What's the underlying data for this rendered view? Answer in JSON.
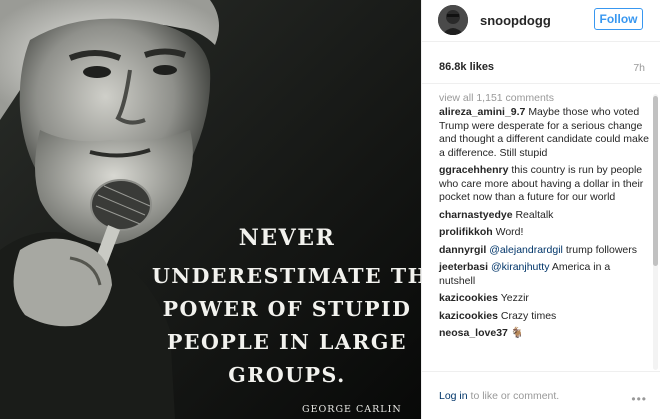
{
  "image": {
    "quote_lines": [
      "NEVER",
      "UNDERESTIMATE THE",
      "POWER OF STUPID",
      "PEOPLE IN LARGE",
      "GROUPS."
    ],
    "attribution": "GEORGE CARLIN"
  },
  "header": {
    "username": "snoopdogg",
    "follow_label": "Follow"
  },
  "stats": {
    "likes": "86.8k likes",
    "time": "7h"
  },
  "comments": {
    "view_all": "view all 1,151 comments",
    "items": [
      {
        "user": "alireza_amini_9.7",
        "text": "Maybe those who voted Trump were desperate for a serious change and thought a different candidate could make a difference. Still stupid"
      },
      {
        "user": "ggracehhenry",
        "text": "this country is run by people who care more about having a dollar in their pocket now than a future for our world"
      },
      {
        "user": "charnastyedye",
        "text": "Realtalk"
      },
      {
        "user": "prolifikkoh",
        "text": "Word!"
      },
      {
        "user": "dannyrgil",
        "mention": "@alejandrardgil",
        "text": "trump followers"
      },
      {
        "user": "jeeterbasi",
        "mention": "@kiranjhutty",
        "text": "America in a nutshell"
      },
      {
        "user": "kazicookies",
        "text": "Yezzir"
      },
      {
        "user": "kazicookies",
        "text": "Crazy times"
      },
      {
        "user": "neosa_love37",
        "text": "🐐"
      }
    ]
  },
  "footer": {
    "login_link": "Log in",
    "login_rest": " to like or comment."
  },
  "colors": {
    "accent": "#3897f0",
    "link": "#003569",
    "muted": "#999999"
  },
  "icons": {
    "more": "more-options-icon"
  }
}
